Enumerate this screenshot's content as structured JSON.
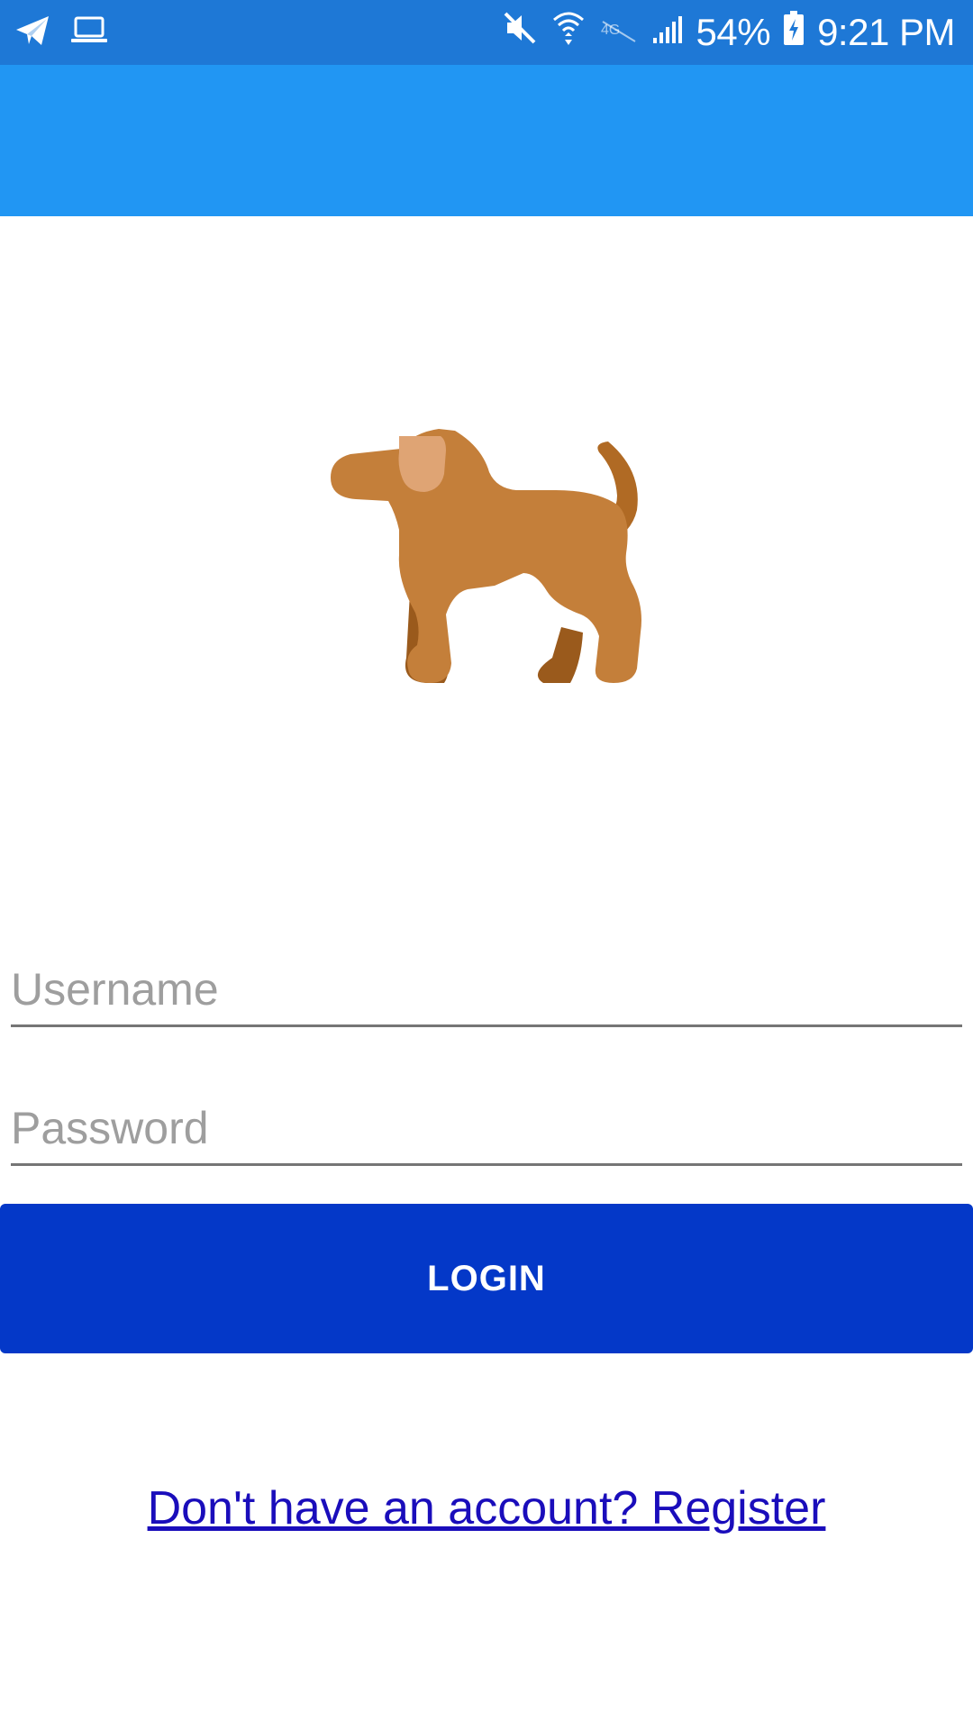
{
  "status_bar": {
    "left_icons": [
      "telegram-icon",
      "laptop-icon"
    ],
    "right_icons": [
      "mute-icon",
      "wifi-icon",
      "lte-icon",
      "signal-icon",
      "battery-charging-icon"
    ],
    "battery": "54%",
    "time": "9:21 PM"
  },
  "app_bar": {
    "color": "#2196f3"
  },
  "logo": {
    "icon": "dog-icon"
  },
  "login_form": {
    "username_placeholder": "Username",
    "username_value": "",
    "password_placeholder": "Password",
    "password_value": "",
    "login_label": "LOGIN",
    "register_link": "Don't have an account? Register"
  },
  "colors": {
    "status_bar": "#1e78d6",
    "app_bar": "#2196f3",
    "login_button": "#0438c8",
    "link": "#1a0dbb",
    "dog_body": "#c47f3a",
    "dog_shadow": "#9a5a1c",
    "dog_ear": "#dfa474"
  }
}
